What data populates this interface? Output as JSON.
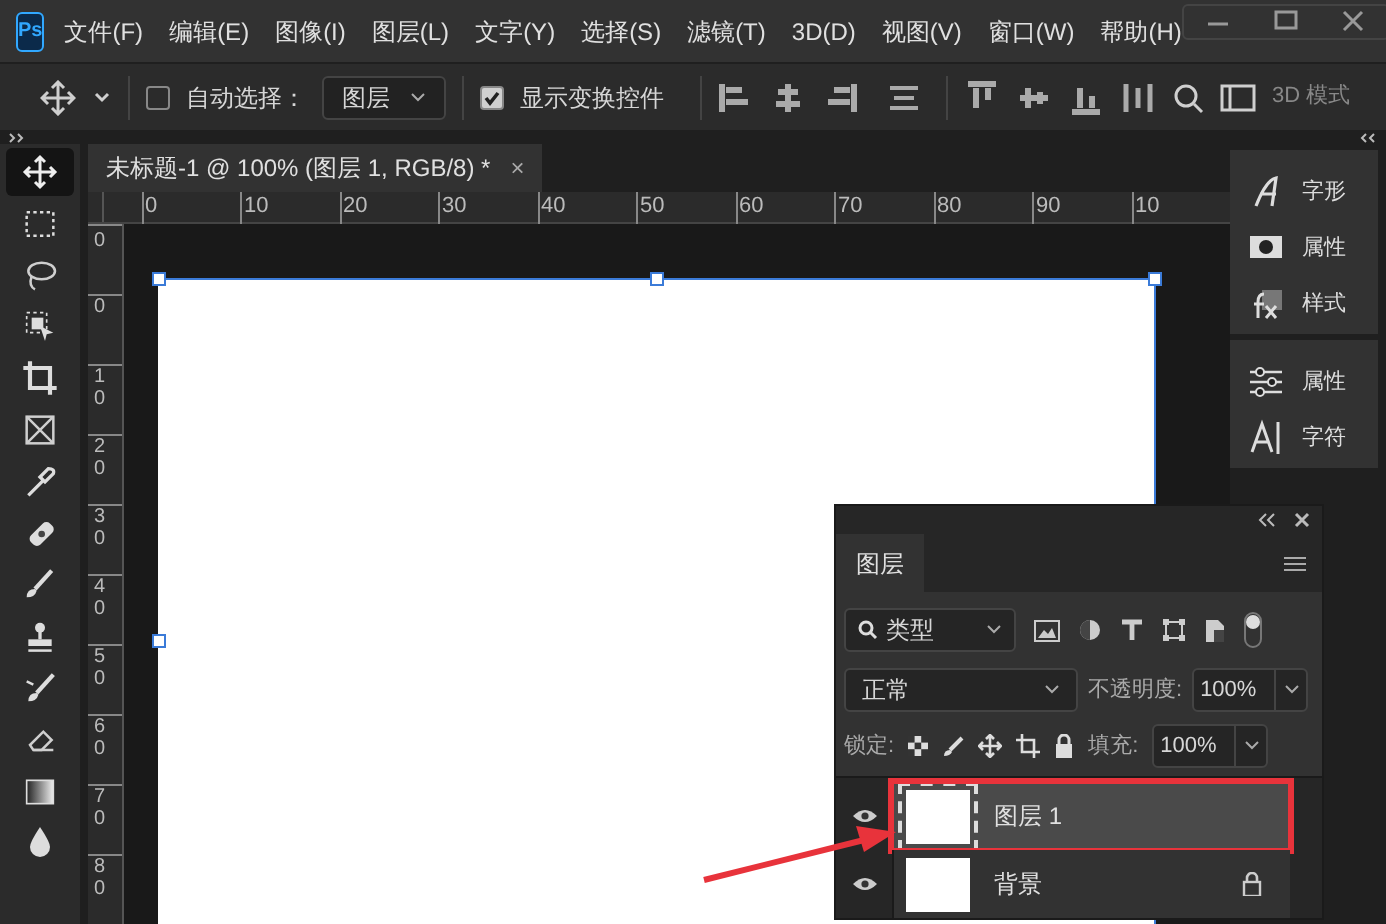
{
  "menubar": {
    "app_logo": "Ps",
    "items": [
      "文件(F)",
      "编辑(E)",
      "图像(I)",
      "图层(L)",
      "文字(Y)",
      "选择(S)",
      "滤镜(T)",
      "3D(D)",
      "视图(V)",
      "窗口(W)",
      "帮助(H)"
    ]
  },
  "options_bar": {
    "auto_select": {
      "label": "自动选择：",
      "checked": false
    },
    "target": "图层",
    "show_transform": {
      "label": "显示变换控件",
      "checked": true
    },
    "mode": "3D 模式"
  },
  "document_tab": {
    "title": "未标题-1 @ 100% (图层 1, RGB/8) *",
    "close": "×"
  },
  "rulers": {
    "horizontal": [
      "0",
      "10",
      "20",
      "30",
      "40",
      "50",
      "60",
      "70",
      "80",
      "90",
      "10"
    ],
    "vertical": [
      "0",
      "0",
      "10",
      "20",
      "30",
      "40",
      "50",
      "60",
      "70",
      "80"
    ]
  },
  "tools": [
    {
      "kind": "move",
      "selected": true
    },
    {
      "kind": "marquee",
      "selected": false
    },
    {
      "kind": "lasso",
      "selected": false
    },
    {
      "kind": "select",
      "selected": false
    },
    {
      "kind": "crop",
      "selected": false
    },
    {
      "kind": "frame",
      "selected": false
    },
    {
      "kind": "eyedropper",
      "selected": false
    },
    {
      "kind": "bandage",
      "selected": false
    },
    {
      "kind": "brush",
      "selected": false
    },
    {
      "kind": "stamp",
      "selected": false
    },
    {
      "kind": "history",
      "selected": false
    },
    {
      "kind": "eraser",
      "selected": false
    },
    {
      "kind": "gradient",
      "selected": false
    },
    {
      "kind": "drop",
      "selected": false
    }
  ],
  "side_panel": {
    "groups": [
      [
        {
          "kind": "glyph",
          "label": "字形"
        },
        {
          "kind": "dot",
          "label": "属性"
        },
        {
          "kind": "fx",
          "label": "样式"
        }
      ],
      [
        {
          "kind": "sliders",
          "label": "属性"
        },
        {
          "kind": "type",
          "label": "字符"
        }
      ]
    ]
  },
  "layers_panel": {
    "title": "图层",
    "filter": "类型",
    "blend_mode": "正常",
    "opacity_label": "不透明度:",
    "opacity": "100%",
    "lock_label": "锁定:",
    "fill_label": "填充:",
    "fill": "100%",
    "layers": [
      {
        "name": "图层 1",
        "selected": true,
        "visible": true,
        "locked": false
      },
      {
        "name": "背景",
        "selected": false,
        "visible": true,
        "locked": true
      }
    ]
  }
}
